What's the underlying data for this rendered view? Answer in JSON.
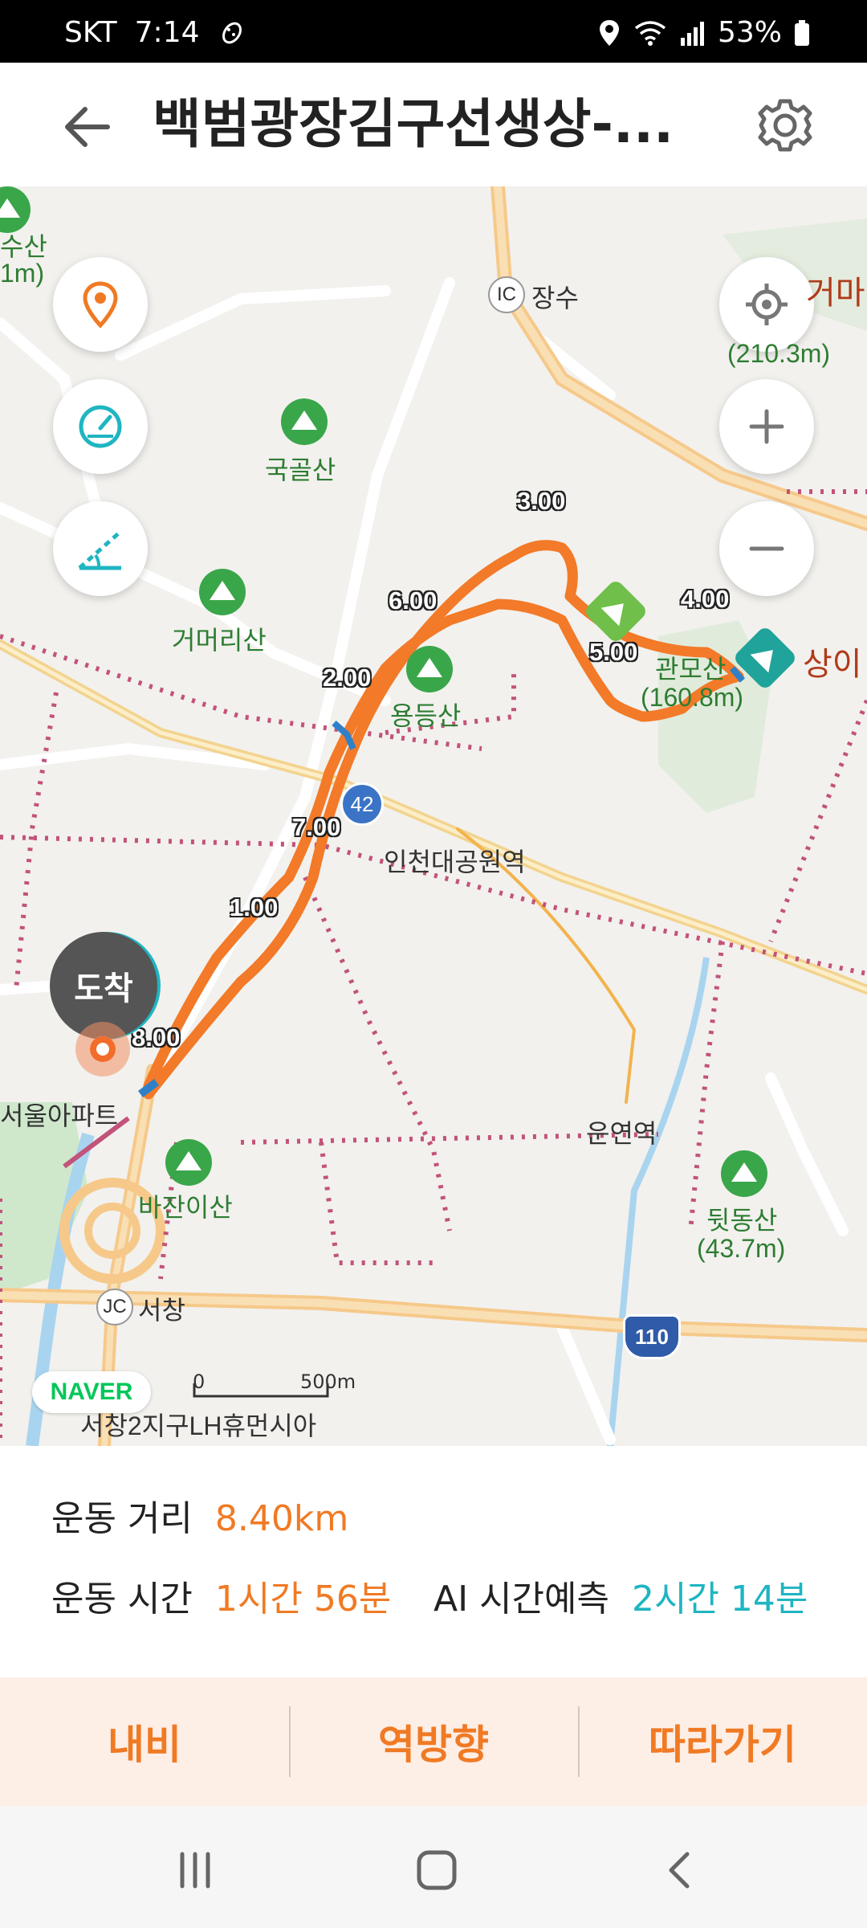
{
  "status_bar": {
    "carrier": "SKT",
    "time": "7:14",
    "battery": "53%"
  },
  "header": {
    "title": "백범광장김구선생상-..."
  },
  "map": {
    "labels": {
      "top_left_peak": "수산",
      "top_left_elev": "1m)",
      "ic_badge": "IC",
      "jangsu": "장수",
      "geoma": "거마",
      "geoma_elev": "(210.3m)",
      "gukgolsan": "국골산",
      "geomeorisan": "거머리산",
      "yongdeungsan": "용등산",
      "gwanmo": "관모산",
      "gwanmo_elev": "(160.8m)",
      "sangi": "상이",
      "incheon_park_station": "인천대공원역",
      "route_42": "42",
      "unyeon_station": "운연역",
      "apartment": "서울아파트",
      "bajanisan": "바잔이산",
      "dwitdongsan": "뒷동산",
      "dwitdongsan_elev": "(43.7m)",
      "jc_badge": "JC",
      "seochang": "서창",
      "highway_110": "110",
      "lh_humansia": "서창2지구LH휴먼시아",
      "scale_zero": "0",
      "scale_500": "500m"
    },
    "km_markers": [
      "1.00",
      "2.00",
      "3.00",
      "4.00",
      "5.00",
      "6.00",
      "7.00",
      "8.00"
    ],
    "arrival": "도착",
    "naver_logo": "NAVER"
  },
  "stats": {
    "distance_label": "운동 거리",
    "distance_value": "8.40km",
    "time_label": "운동 시간",
    "time_value": "1시간 56분",
    "ai_label": "AI 시간예측",
    "ai_value": "2시간 14분"
  },
  "actions": {
    "navi": "내비",
    "reverse": "역방향",
    "follow": "따라가기"
  },
  "colors": {
    "accent_orange": "#f07a24",
    "accent_teal": "#1fb5c2",
    "route": "#f27a28",
    "marker_blue": "#2f2f9e"
  }
}
